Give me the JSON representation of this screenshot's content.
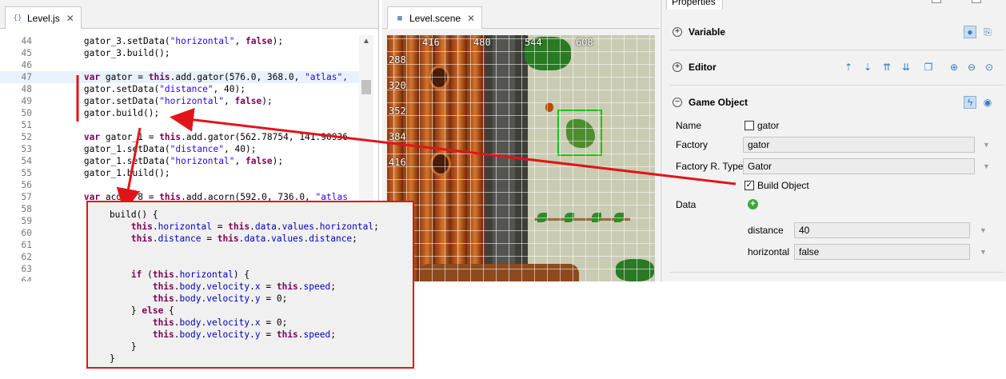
{
  "editor": {
    "tab_label": "Level.js",
    "tab_icon": "js-file-icon",
    "lines": [
      {
        "n": "44",
        "code": [
          [
            "",
            "        gator_3.setData("
          ],
          [
            "str",
            "\"horizontal\""
          ],
          [
            "",
            ", "
          ],
          [
            "lit",
            "false"
          ],
          [
            "",
            ");"
          ]
        ]
      },
      {
        "n": "45",
        "code": [
          [
            "",
            "        gator_3.build();"
          ]
        ]
      },
      {
        "n": "46",
        "code": [
          [
            "",
            ""
          ]
        ]
      },
      {
        "n": "47",
        "code": [
          [
            "kw",
            "        var"
          ],
          [
            "",
            " gator = "
          ],
          [
            "kw",
            "this"
          ],
          [
            "",
            ".add.gator(576.0, 368.0, "
          ],
          [
            "str",
            "\"atlas\","
          ]
        ]
      },
      {
        "n": "48",
        "code": [
          [
            "",
            "        gator.setData("
          ],
          [
            "str",
            "\"distance\""
          ],
          [
            "",
            ", 40);"
          ]
        ]
      },
      {
        "n": "49",
        "code": [
          [
            "",
            "        gator.setData("
          ],
          [
            "str",
            "\"horizontal\""
          ],
          [
            "",
            ", "
          ],
          [
            "lit",
            "false"
          ],
          [
            "",
            ");"
          ]
        ]
      },
      {
        "n": "50",
        "code": [
          [
            "",
            "        gator.build();"
          ]
        ]
      },
      {
        "n": "51",
        "code": [
          [
            "",
            ""
          ]
        ]
      },
      {
        "n": "52",
        "code": [
          [
            "kw",
            "        var"
          ],
          [
            "",
            " gator_1 = "
          ],
          [
            "kw",
            "this"
          ],
          [
            "",
            ".add.gator(562.78754, 141.90936"
          ]
        ]
      },
      {
        "n": "53",
        "code": [
          [
            "",
            "        gator_1.setData("
          ],
          [
            "str",
            "\"distance\""
          ],
          [
            "",
            ", 40);"
          ]
        ]
      },
      {
        "n": "54",
        "code": [
          [
            "",
            "        gator_1.setData("
          ],
          [
            "str",
            "\"horizontal\""
          ],
          [
            "",
            ", "
          ],
          [
            "lit",
            "false"
          ],
          [
            "",
            ");"
          ]
        ]
      },
      {
        "n": "55",
        "code": [
          [
            "",
            "        gator_1.build();"
          ]
        ]
      },
      {
        "n": "56",
        "code": [
          [
            "",
            ""
          ]
        ]
      },
      {
        "n": "57",
        "code": [
          [
            "kw",
            "        var"
          ],
          [
            "",
            " acorn_8 = "
          ],
          [
            "kw",
            "this"
          ],
          [
            "",
            ".add.acorn(592.0, 736.0, "
          ],
          [
            "str",
            "\"atlas"
          ]
        ]
      },
      {
        "n": "58",
        "code": [
          [
            "",
            ""
          ]
        ]
      },
      {
        "n": "59",
        "code": [
          [
            "",
            ""
          ]
        ]
      },
      {
        "n": "60",
        "code": [
          [
            "",
            ""
          ]
        ]
      },
      {
        "n": "61",
        "code": [
          [
            "",
            ""
          ]
        ]
      },
      {
        "n": "62",
        "code": [
          [
            "",
            ""
          ]
        ]
      },
      {
        "n": "63",
        "code": [
          [
            "",
            ""
          ]
        ]
      },
      {
        "n": "64",
        "code": [
          [
            "",
            ""
          ]
        ]
      }
    ]
  },
  "scene": {
    "tab_label": "Level.scene",
    "tab_icon": "scene-file-icon",
    "ruler_x": [
      "416",
      "480",
      "544",
      "608"
    ],
    "ruler_y": [
      "288",
      "320",
      "352",
      "384",
      "416"
    ]
  },
  "properties": {
    "tab_label": "Properties",
    "sections": {
      "variable": "Variable",
      "editor": "Editor",
      "game_object": "Game Object"
    },
    "fields": {
      "name_label": "Name",
      "name_value": "gator",
      "factory_label": "Factory",
      "factory_value": "gator",
      "factory_type_label": "Factory R. Type",
      "factory_type_value": "Gator",
      "build_object_label": "Build Object",
      "build_object_checked": true,
      "data_label": "Data",
      "distance_label": "distance",
      "distance_value": "40",
      "horizontal_label": "horizontal",
      "horizontal_value": "false"
    }
  },
  "popup": {
    "lines": [
      [
        [
          "",
          "    build() {"
        ]
      ],
      [
        [
          "",
          "        "
        ],
        [
          "kw",
          "this"
        ],
        [
          "",
          "."
        ],
        [
          "fld",
          "horizontal"
        ],
        [
          "",
          " = "
        ],
        [
          "kw",
          "this"
        ],
        [
          "",
          "."
        ],
        [
          "fld",
          "data"
        ],
        [
          "",
          "."
        ],
        [
          "fld",
          "values"
        ],
        [
          "",
          "."
        ],
        [
          "fld",
          "horizontal"
        ],
        [
          "",
          ";"
        ]
      ],
      [
        [
          "",
          "        "
        ],
        [
          "kw",
          "this"
        ],
        [
          "",
          "."
        ],
        [
          "fld",
          "distance"
        ],
        [
          "",
          " = "
        ],
        [
          "kw",
          "this"
        ],
        [
          "",
          "."
        ],
        [
          "fld",
          "data"
        ],
        [
          "",
          "."
        ],
        [
          "fld",
          "values"
        ],
        [
          "",
          "."
        ],
        [
          "fld",
          "distance"
        ],
        [
          "",
          ";"
        ]
      ],
      [
        [
          "",
          ""
        ]
      ],
      [
        [
          "",
          ""
        ]
      ],
      [
        [
          "",
          "        "
        ],
        [
          "kw",
          "if"
        ],
        [
          "",
          " ("
        ],
        [
          "kw",
          "this"
        ],
        [
          "",
          "."
        ],
        [
          "fld",
          "horizontal"
        ],
        [
          "",
          ") {"
        ]
      ],
      [
        [
          "",
          "            "
        ],
        [
          "kw",
          "this"
        ],
        [
          "",
          "."
        ],
        [
          "fld",
          "body"
        ],
        [
          "",
          "."
        ],
        [
          "fld",
          "velocity"
        ],
        [
          "",
          "."
        ],
        [
          "fld",
          "x"
        ],
        [
          "",
          " = "
        ],
        [
          "kw",
          "this"
        ],
        [
          "",
          "."
        ],
        [
          "fld",
          "speed"
        ],
        [
          "",
          ";"
        ]
      ],
      [
        [
          "",
          "            "
        ],
        [
          "kw",
          "this"
        ],
        [
          "",
          "."
        ],
        [
          "fld",
          "body"
        ],
        [
          "",
          "."
        ],
        [
          "fld",
          "velocity"
        ],
        [
          "",
          "."
        ],
        [
          "fld",
          "y"
        ],
        [
          "",
          " = 0;"
        ]
      ],
      [
        [
          "",
          "        } "
        ],
        [
          "kw",
          "else"
        ],
        [
          "",
          " {"
        ]
      ],
      [
        [
          "",
          "            "
        ],
        [
          "kw",
          "this"
        ],
        [
          "",
          "."
        ],
        [
          "fld",
          "body"
        ],
        [
          "",
          "."
        ],
        [
          "fld",
          "velocity"
        ],
        [
          "",
          "."
        ],
        [
          "fld",
          "x"
        ],
        [
          "",
          " = 0;"
        ]
      ],
      [
        [
          "",
          "            "
        ],
        [
          "kw",
          "this"
        ],
        [
          "",
          "."
        ],
        [
          "fld",
          "body"
        ],
        [
          "",
          "."
        ],
        [
          "fld",
          "velocity"
        ],
        [
          "",
          "."
        ],
        [
          "fld",
          "y"
        ],
        [
          "",
          " = "
        ],
        [
          "kw",
          "this"
        ],
        [
          "",
          "."
        ],
        [
          "fld",
          "speed"
        ],
        [
          "",
          ";"
        ]
      ],
      [
        [
          "",
          "        }"
        ]
      ],
      [
        [
          "",
          "    }"
        ]
      ]
    ]
  },
  "colors": {
    "annotation": "#e0151a",
    "keyword": "#7f0055",
    "string": "#2a00ff",
    "field": "#0000c0",
    "selection": "#19c219"
  }
}
